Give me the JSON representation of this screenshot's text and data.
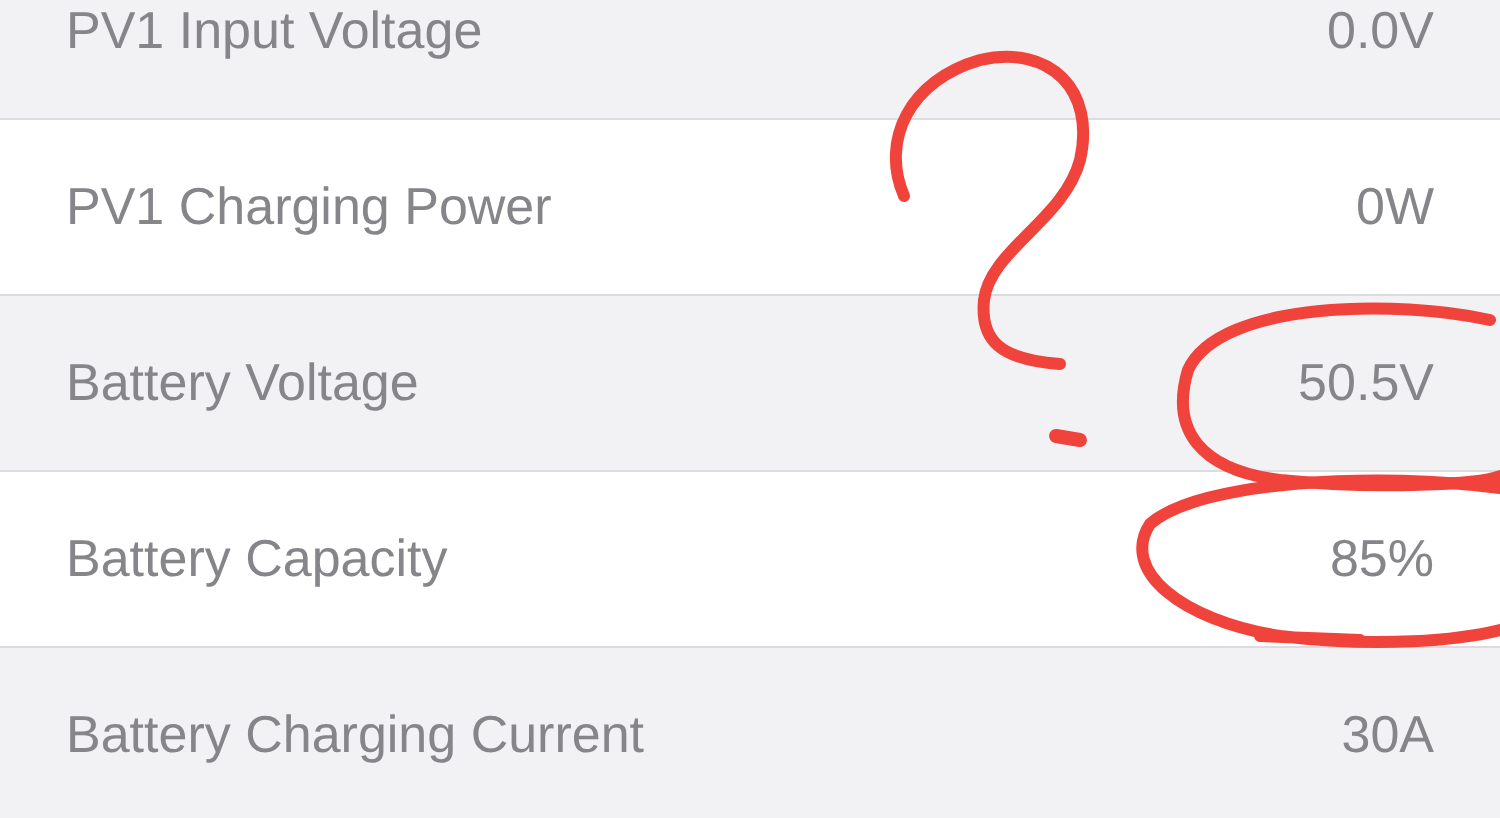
{
  "rows": [
    {
      "label": "PV1 Input Voltage",
      "value": "0.0V"
    },
    {
      "label": "PV1 Charging Power",
      "value": "0W"
    },
    {
      "label": "Battery Voltage",
      "value": "50.5V"
    },
    {
      "label": "Battery Capacity",
      "value": "85%"
    },
    {
      "label": "Battery Charging Current",
      "value": "30A"
    }
  ]
}
